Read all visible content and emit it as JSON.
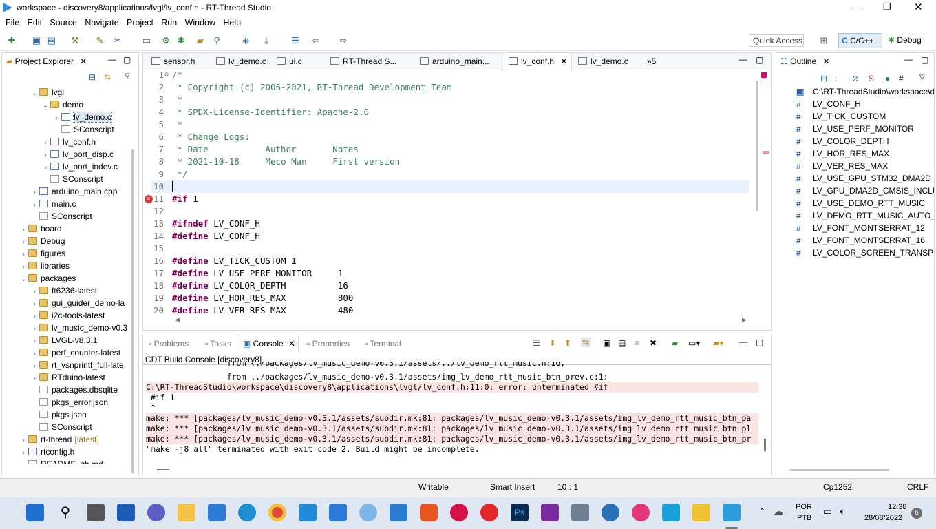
{
  "window": {
    "title": "workspace - discovery8/applications/lvgl/lv_conf.h - RT-Thread Studio"
  },
  "menu": [
    "File",
    "Edit",
    "Source",
    "Navigate",
    "Project",
    "Run",
    "Window",
    "Help"
  ],
  "toolbar": {
    "quick_access": "Quick Access",
    "perspective_cpp": "C/C++",
    "perspective_debug": "Debug"
  },
  "project_explorer": {
    "title": "Project Explorer",
    "items": [
      {
        "label": "lvgl",
        "type": "folder",
        "level": 2,
        "expanded": true
      },
      {
        "label": "demo",
        "type": "folder",
        "level": 3,
        "expanded": true
      },
      {
        "label": "lv_demo.c",
        "type": "c",
        "level": 4,
        "selected": true
      },
      {
        "label": "SConscript",
        "type": "s",
        "level": 4
      },
      {
        "label": "lv_conf.h",
        "type": "h",
        "level": 3
      },
      {
        "label": "lv_port_disp.c",
        "type": "c",
        "level": 3
      },
      {
        "label": "lv_port_indev.c",
        "type": "c",
        "level": 3
      },
      {
        "label": "SConscript",
        "type": "s",
        "level": 3
      },
      {
        "label": "arduino_main.cpp",
        "type": "c",
        "level": 2
      },
      {
        "label": "main.c",
        "type": "c",
        "level": 2
      },
      {
        "label": "SConscript",
        "type": "s",
        "level": 2
      },
      {
        "label": "board",
        "type": "folder",
        "level": 1
      },
      {
        "label": "Debug",
        "type": "folder",
        "level": 1
      },
      {
        "label": "figures",
        "type": "folder",
        "level": 1
      },
      {
        "label": "libraries",
        "type": "folder",
        "level": 1
      },
      {
        "label": "packages",
        "type": "folder",
        "level": 1,
        "expanded": true
      },
      {
        "label": "ft6236-latest",
        "type": "folder",
        "level": 2
      },
      {
        "label": "gui_guider_demo-la",
        "type": "folder",
        "level": 2
      },
      {
        "label": "i2c-tools-latest",
        "type": "folder",
        "level": 2
      },
      {
        "label": "lv_music_demo-v0.3",
        "type": "folder",
        "level": 2
      },
      {
        "label": "LVGL-v8.3.1",
        "type": "folder",
        "level": 2
      },
      {
        "label": "perf_counter-latest",
        "type": "folder",
        "level": 2
      },
      {
        "label": "rt_vsnprintf_full-late",
        "type": "folder",
        "level": 2
      },
      {
        "label": "RTduino-latest",
        "type": "folder",
        "level": 2
      },
      {
        "label": "packages.dbsqlite",
        "type": "s",
        "level": 2
      },
      {
        "label": "pkgs_error.json",
        "type": "s",
        "level": 2
      },
      {
        "label": "pkgs.json",
        "type": "s",
        "level": 2
      },
      {
        "label": "SConscript",
        "type": "s",
        "level": 2
      },
      {
        "label": "rt-thread",
        "type": "folder",
        "level": 1,
        "suffix": "[latest]"
      },
      {
        "label": "rtconfig.h",
        "type": "h",
        "level": 1
      },
      {
        "label": "README_zh.md",
        "type": "s",
        "level": 1
      }
    ]
  },
  "editor_tabs": [
    {
      "label": "sensor.h"
    },
    {
      "label": "lv_demo.c"
    },
    {
      "label": "ui.c"
    },
    {
      "label": "RT-Thread S..."
    },
    {
      "label": "arduino_main..."
    },
    {
      "label": "lv_conf.h",
      "active": true
    },
    {
      "label": "lv_demo.c"
    },
    {
      "label": "»5"
    }
  ],
  "code_lines": [
    {
      "n": "1",
      "text": "/*",
      "cls": "cm",
      "fold": "⊖"
    },
    {
      "n": "2",
      "text": " * Copyright (c) 2006-2021, RT-Thread Development Team",
      "cls": "cm"
    },
    {
      "n": "3",
      "text": " *",
      "cls": "cm"
    },
    {
      "n": "4",
      "text": " * SPDX-License-Identifier: Apache-2.0",
      "cls": "cm"
    },
    {
      "n": "5",
      "text": " *",
      "cls": "cm"
    },
    {
      "n": "6",
      "text": " * Change Logs:",
      "cls": "cm"
    },
    {
      "n": "7",
      "text": " * Date           Author       Notes",
      "cls": "cm"
    },
    {
      "n": "8",
      "text": " * 2021-10-18     Meco Man     First version",
      "cls": "cm"
    },
    {
      "n": "9",
      "text": " */",
      "cls": "cm"
    },
    {
      "n": "10",
      "text": "",
      "cls": "",
      "current": true
    },
    {
      "n": "11",
      "kw": "#if",
      "rest": " 1",
      "error": true
    },
    {
      "n": "12",
      "text": "",
      "cls": ""
    },
    {
      "n": "13",
      "kw": "#ifndef",
      "rest": " LV_CONF_H"
    },
    {
      "n": "14",
      "kw": "#define",
      "rest": " LV_CONF_H"
    },
    {
      "n": "15",
      "text": "",
      "cls": ""
    },
    {
      "n": "16",
      "kw": "#define",
      "rest": " LV_TICK_CUSTOM 1"
    },
    {
      "n": "17",
      "kw": "#define",
      "rest": " LV_USE_PERF_MONITOR     1"
    },
    {
      "n": "18",
      "kw": "#define",
      "rest": " LV_COLOR_DEPTH          16"
    },
    {
      "n": "19",
      "kw": "#define",
      "rest": " LV_HOR_RES_MAX          800"
    },
    {
      "n": "20",
      "kw": "#define",
      "rest": " LV_VER_RES_MAX          480"
    }
  ],
  "outline": {
    "title": "Outline",
    "items": [
      {
        "label": "C:\\RT-ThreadStudio\\workspace\\d",
        "icon": "include"
      },
      {
        "label": "LV_CONF_H"
      },
      {
        "label": "LV_TICK_CUSTOM"
      },
      {
        "label": "LV_USE_PERF_MONITOR"
      },
      {
        "label": "LV_COLOR_DEPTH"
      },
      {
        "label": "LV_HOR_RES_MAX"
      },
      {
        "label": "LV_VER_RES_MAX"
      },
      {
        "label": "LV_USE_GPU_STM32_DMA2D"
      },
      {
        "label": "LV_GPU_DMA2D_CMSIS_INCLUDE"
      },
      {
        "label": "LV_USE_DEMO_RTT_MUSIC"
      },
      {
        "label": "LV_DEMO_RTT_MUSIC_AUTO_PLA"
      },
      {
        "label": "LV_FONT_MONTSERRAT_12"
      },
      {
        "label": "LV_FONT_MONTSERRAT_16"
      },
      {
        "label": "LV_COLOR_SCREEN_TRANSP"
      }
    ]
  },
  "bottom_tabs": [
    {
      "label": "Problems"
    },
    {
      "label": "Tasks"
    },
    {
      "label": "Console",
      "active": true
    },
    {
      "label": "Properties"
    },
    {
      "label": "Terminal"
    }
  ],
  "console": {
    "title": "CDT Build Console [discovery8]",
    "lines": [
      {
        "text": "                 from ../packages/lv_music_demo-v0.3.1/assets/../lv_demo_rtt_music.h:16,",
        "err": false
      },
      {
        "text": "                 from ../packages/lv_music_demo-v0.3.1/assets/img_lv_demo_rtt_music_btn_prev.c:1:",
        "err": false
      },
      {
        "text": "C:\\RT-ThreadStudio\\workspace\\discovery8\\applications\\lvgl/lv_conf.h:11:0: error: unterminated #if",
        "err": true
      },
      {
        "text": " #if 1",
        "err": false
      },
      {
        "text": " ^",
        "err": false
      },
      {
        "text": "make: *** [packages/lv_music_demo-v0.3.1/assets/subdir.mk:81: packages/lv_music_demo-v0.3.1/assets/img_lv_demo_rtt_music_btn_pa",
        "err": true
      },
      {
        "text": "make: *** [packages/lv_music_demo-v0.3.1/assets/subdir.mk:81: packages/lv_music_demo-v0.3.1/assets/img_lv_demo_rtt_music_btn_pl",
        "err": true
      },
      {
        "text": "make: *** [packages/lv_music_demo-v0.3.1/assets/subdir.mk:81: packages/lv_music_demo-v0.3.1/assets/img_lv_demo_rtt_music_btn_pr",
        "err": true
      },
      {
        "text": "\"make -j8 all\" terminated with exit code 2. Build might be incomplete.",
        "err": false
      }
    ]
  },
  "status": {
    "writable": "Writable",
    "insert": "Smart Insert",
    "position": "10 : 1",
    "encoding": "Cp1252",
    "line_ending": "CRLF"
  },
  "taskbar": {
    "lang": "POR",
    "layout": "PTB",
    "time": "12:38",
    "date": "28/08/2022",
    "notifications": "6"
  },
  "colors": {
    "accent": "#2d6aa8",
    "error_bg": "#fde4e4",
    "keyword": "#7f0055",
    "comment": "#3f7f5f",
    "current_line": "#e8f2fe"
  }
}
